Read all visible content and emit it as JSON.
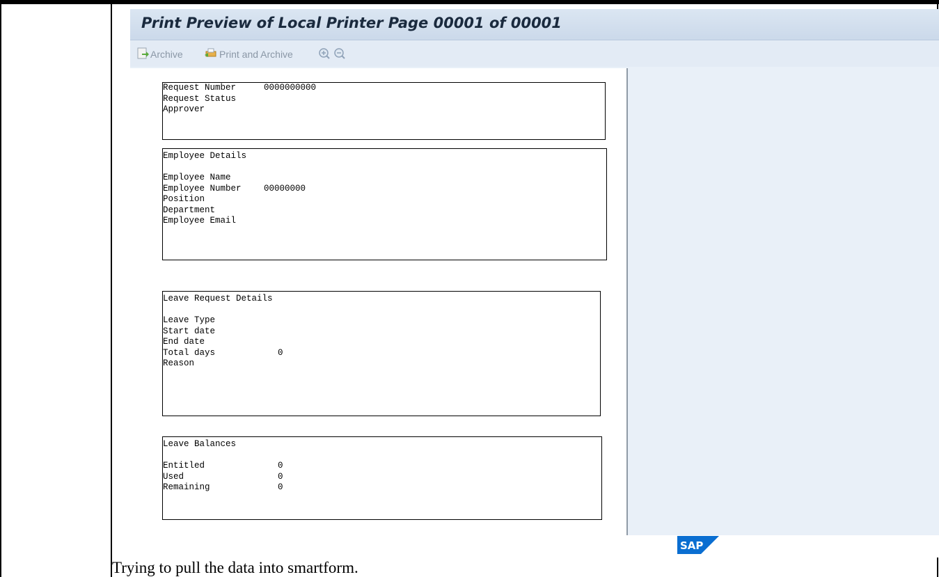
{
  "window": {
    "title": "Print Preview of Local Printer Page 00001 of 00001"
  },
  "toolbar": {
    "archive_label": "Archive",
    "print_archive_label": "Print and Archive"
  },
  "form": {
    "request": {
      "rows": [
        {
          "label": "Request Number",
          "value": "0000000000"
        },
        {
          "label": "Request Status",
          "value": ""
        },
        {
          "label": "Approver",
          "value": ""
        }
      ]
    },
    "employee": {
      "heading": "Employee Details",
      "rows": [
        {
          "label": "Employee Name",
          "value": ""
        },
        {
          "label": "Employee Number",
          "value": "00000000"
        },
        {
          "label": "Position",
          "value": ""
        },
        {
          "label": "Department",
          "value": ""
        },
        {
          "label": "Employee Email",
          "value": ""
        }
      ]
    },
    "leave_request": {
      "heading": "Leave Request Details",
      "rows": [
        {
          "label": "Leave Type",
          "value": ""
        },
        {
          "label": "Start date",
          "value": ""
        },
        {
          "label": "End date",
          "value": ""
        },
        {
          "label": "Total days",
          "value": "0"
        },
        {
          "label": "Reason",
          "value": ""
        }
      ]
    },
    "balances": {
      "heading": "Leave Balances",
      "rows": [
        {
          "label": "Entitled",
          "value": "0"
        },
        {
          "label": "Used",
          "value": "0"
        },
        {
          "label": "Remaining",
          "value": "0"
        }
      ]
    }
  },
  "brand": {
    "logo_text": "SAP",
    "colors": {
      "sap_blue": "#0a6ed1",
      "title_bg": "#cbd9ea",
      "pane_bg": "#e9f0f8"
    }
  },
  "caption": "Trying to pull the data into smartform."
}
